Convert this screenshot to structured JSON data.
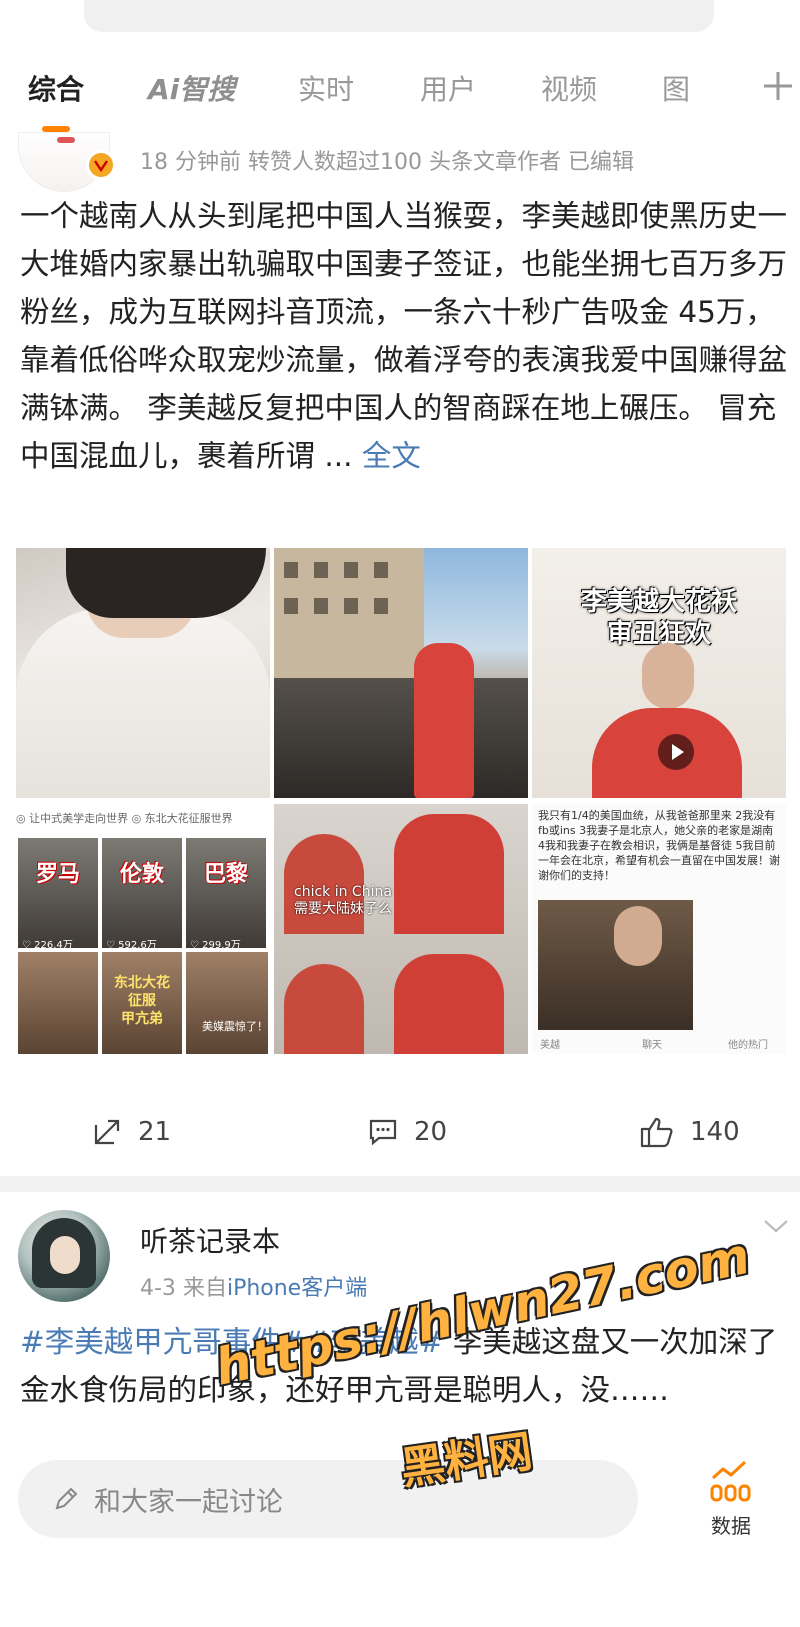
{
  "tabs": [
    {
      "label": "综合"
    },
    {
      "label": "Ai智搜"
    },
    {
      "label": "实时"
    },
    {
      "label": "用户"
    },
    {
      "label": "视频"
    },
    {
      "label": "图"
    }
  ],
  "post1": {
    "meta": "18 分钟前  转赞人数超过100  头条文章作者  已编辑",
    "text": "一个越南人从头到尾把中国人当猴耍，李美越即使黑历史一大堆婚内家暴出轨骗取中国妻子签证，也能坐拥七百万多万粉丝，成为互联网抖音顶流，一条六十秒广告吸金 45万，靠着低俗哗众取宠炒流量，做着浮夸的表演我爱中国赚得盆满钵满。 李美越反复把中国人的智商踩在地上碾压。 冒充中国混血儿，裹着所谓 ...",
    "more_label": "全文",
    "images": {
      "img3_title": "李美越大花袄\n审丑狂欢",
      "img4_header": "◎ 让中式美学走向世界      ◎ 东北大花征服世界",
      "img4_labels": [
        "罗马",
        "伦敦",
        "巴黎"
      ],
      "img4_counts": [
        "♡ 226.4万",
        "♡ 592.6万",
        "♡ 299.9万"
      ],
      "img4_banner": "东北大花\n征服\n甲亢弟",
      "img4_caption": "美媒震惊了！",
      "img5_caption": "chick in China\n需要大陆妹子么",
      "img6_note": "我只有1/4的美国血统，从我爸爸那里来 2我没有fb或ins 3我妻子是北京人，她父亲的老家是湖南 4我和我妻子在教会相识，我俩是基督徒 5我目前一年会在北京，希望有机会一直留在中国发展！谢谢你们的支持！",
      "img6_footer": [
        "美越",
        "聊天",
        "他的热门"
      ]
    },
    "actions": {
      "reposts": "21",
      "comments": "20",
      "likes": "140"
    }
  },
  "post2": {
    "name": "听茶记录本",
    "date": "4-3",
    "source_prefix": "来自",
    "source": "iPhone客户端",
    "tag1": "#李美越甲亢哥事件#",
    "tag2": "#李美越#",
    "text": " 李美越这盘又一次加深了金水食伤局的印象，还好甲亢哥是聪明人，没……"
  },
  "bottom": {
    "comment_placeholder": "和大家一起讨论",
    "data_label": "数据"
  },
  "watermark": {
    "line1": "https://hlwn27.com",
    "line2": "黑料网"
  },
  "colors": {
    "accent": "#ff8200",
    "link": "#4a7bb5",
    "watermark": "#ffb23f"
  }
}
